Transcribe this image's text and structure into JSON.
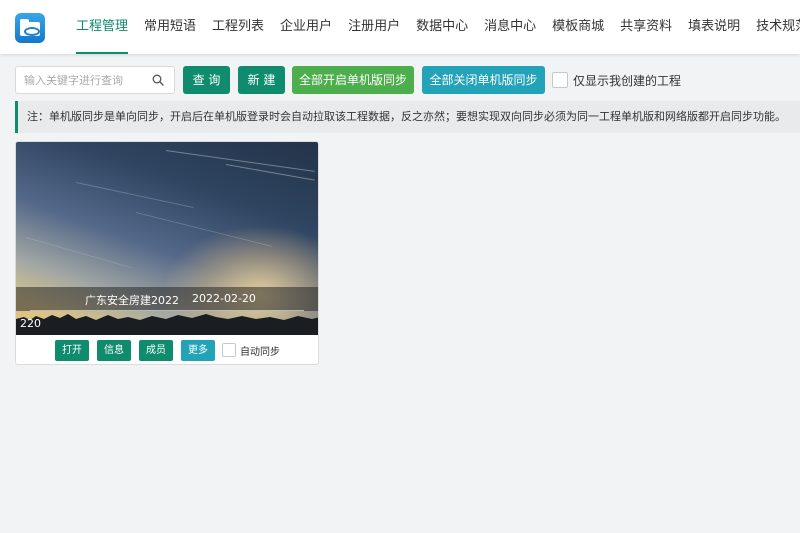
{
  "nav": {
    "items": [
      {
        "label": "工程管理",
        "active": true
      },
      {
        "label": "常用短语"
      },
      {
        "label": "工程列表"
      },
      {
        "label": "企业用户"
      },
      {
        "label": "注册用户"
      },
      {
        "label": "数据中心"
      },
      {
        "label": "消息中心"
      },
      {
        "label": "模板商城"
      },
      {
        "label": "共享资料"
      },
      {
        "label": "填表说明"
      },
      {
        "label": "技术规范"
      }
    ]
  },
  "toolbar": {
    "search_placeholder": "输入关键字进行查询",
    "query_label": "查 询",
    "new_label": "新 建",
    "open_all_sync_label": "全部开启单机版同步",
    "close_all_sync_label": "全部关闭单机版同步",
    "only_mine_label": "仅显示我创建的工程"
  },
  "notice": {
    "text": "注：单机版同步是单向同步，开启后在单机版登录时会自动拉取该工程数据，反之亦然；要想实现双向同步必须为同一工程单机版和网络版都开启同步功能。"
  },
  "projects": [
    {
      "title": "广东安全房建2022",
      "date": "2022-02-20",
      "count": "220",
      "actions": {
        "open": "打开",
        "info": "信息",
        "members": "成员",
        "more": "更多",
        "auto_sync": "自动同步"
      }
    }
  ],
  "colors": {
    "primary": "#0f8b6e",
    "success": "#4cae4c",
    "info": "#23a3b8"
  },
  "icons": {
    "logo": "app-folder-icon",
    "search": "search-icon"
  }
}
